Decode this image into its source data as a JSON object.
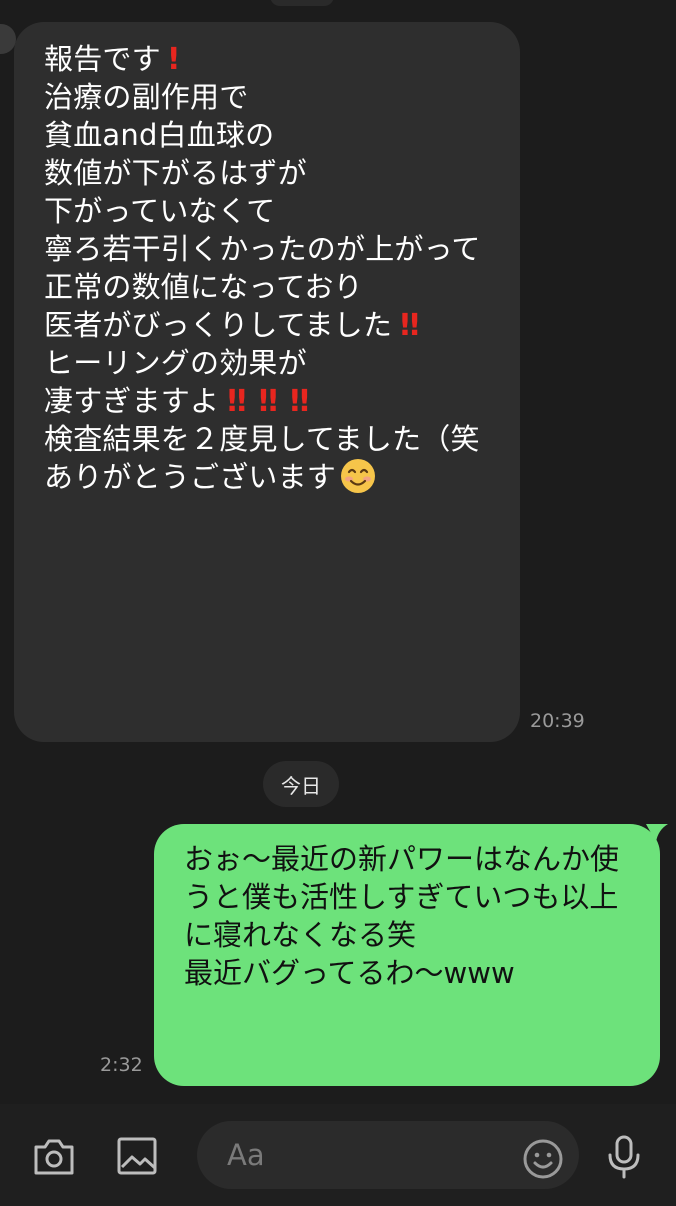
{
  "incoming": {
    "lines": [
      "報告です",
      "",
      "治療の副作用で",
      "貧血and白血球の",
      "数値が下がるはずが",
      "下がっていなくて",
      "寧ろ若干引くかったのが上がって",
      "正常の数値になっており",
      "医者がびっくりしてました",
      "ヒーリングの効果が",
      "凄すぎますよ",
      "検査結果を２度見してました（笑",
      "",
      "ありがとうございます"
    ],
    "time": "20:39"
  },
  "date_divider": "今日",
  "outgoing": {
    "lines": [
      "おぉ〜最近の新パワーはなんか使",
      "うと僕も活性しすぎていつも以上",
      "に寝れなくなる笑",
      "最近バグってるわ〜www"
    ],
    "time": "2:32"
  },
  "composer": {
    "placeholder": "Aa",
    "icons": [
      "camera-icon",
      "image-icon",
      "emoji-icon",
      "microphone-icon"
    ]
  },
  "colors": {
    "background": "#1c1c1c",
    "incoming_bubble": "#2e2e2e",
    "outgoing_bubble": "#6de27b",
    "exclamation": "#e8261f"
  }
}
